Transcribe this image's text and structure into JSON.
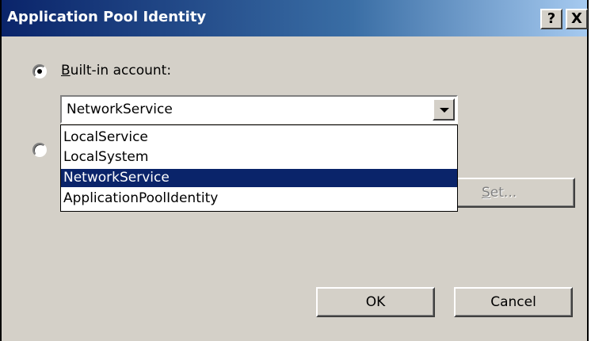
{
  "window": {
    "title": "Application Pool Identity",
    "help_glyph": "?",
    "close_glyph": "X"
  },
  "identity": {
    "builtin_label_accesskey": "B",
    "builtin_label_rest": "uilt-in account:",
    "builtin_selected": true,
    "custom_selected": false,
    "combo_value": "NetworkService",
    "options": [
      "LocalService",
      "LocalSystem",
      "NetworkService",
      "ApplicationPoolIdentity"
    ],
    "highlighted_option": "NetworkService"
  },
  "buttons": {
    "set_accesskey": "S",
    "set_rest": "et...",
    "ok": "OK",
    "cancel": "Cancel"
  },
  "colors": {
    "title_bar_start": "#0a246a",
    "title_bar_end": "#a6caf0",
    "dialog_face": "#d4d0c8",
    "selection_highlight": "#0a246a"
  }
}
